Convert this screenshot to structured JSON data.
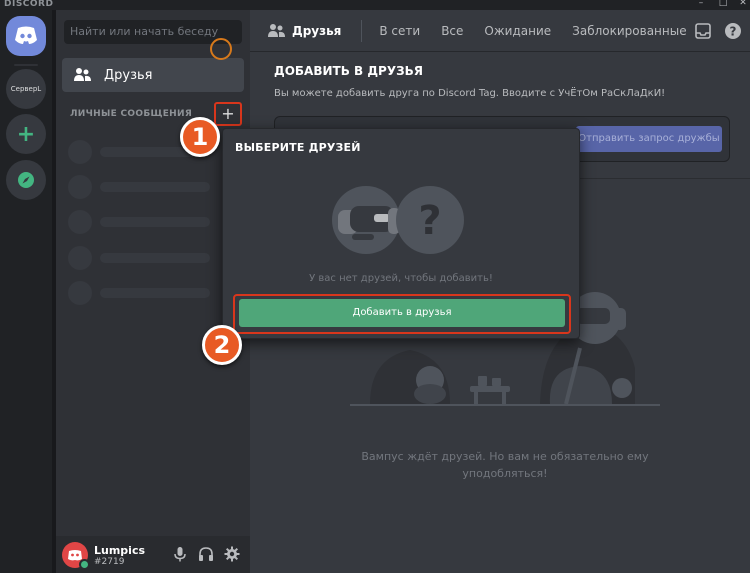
{
  "app": {
    "brand": "DISCORD"
  },
  "rail": {
    "guild_label": "СерверL"
  },
  "sidebar": {
    "search_placeholder": "Найти или начать беседу",
    "friends_label": "Друзья",
    "dm_header": "ЛИЧНЫЕ СООБЩЕНИЯ",
    "dm_add": "+"
  },
  "user": {
    "name": "Lumpics",
    "tag": "#2719"
  },
  "topbar": {
    "title": "Друзья",
    "tabs": [
      "В сети",
      "Все",
      "Ожидание",
      "Заблокированные"
    ]
  },
  "add_friend": {
    "title": "ДОБАВИТЬ В ДРУЗЬЯ",
    "description": "Вы можете добавить друга по Discord Tag. Вводите с УчЁтОм РаСкЛаДкИ!",
    "send_button": "Отправить запрос дружбы"
  },
  "popup": {
    "title": "ВЫБЕРИТЕ ДРУЗЕЙ",
    "empty_text": "У вас нет друзей, чтобы добавить!",
    "button": "Добавить в друзья"
  },
  "empty_state": {
    "line1": "Вампус ждёт друзей. Но вам не обязательно ему",
    "line2": "уподобляться!"
  },
  "markers": [
    "1",
    "2"
  ],
  "colors": {
    "accent": "#7289da",
    "green": "#43b581",
    "highlight": "#d8361c",
    "marker": "#e85a24"
  }
}
